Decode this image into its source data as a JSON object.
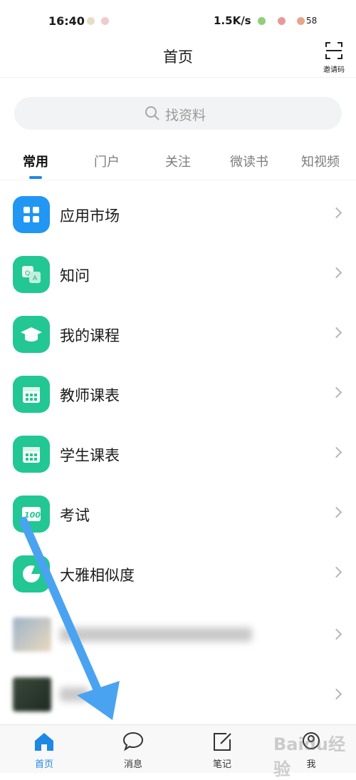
{
  "status_bar": {
    "time": "16:40",
    "net_speed": "1.5K/s",
    "battery": "58"
  },
  "header": {
    "title": "首页",
    "invite_label": "邀请码"
  },
  "search": {
    "placeholder": "找资料"
  },
  "tabs": [
    {
      "label": "常用",
      "active": true
    },
    {
      "label": "门户"
    },
    {
      "label": "关注"
    },
    {
      "label": "微读书"
    },
    {
      "label": "知视频"
    }
  ],
  "list": [
    {
      "label": "应用市场",
      "icon": "app-grid-icon",
      "color": "#2196f3"
    },
    {
      "label": "知问",
      "icon": "qa-icon",
      "color": "#22c793"
    },
    {
      "label": "我的课程",
      "icon": "graduation-cap-icon",
      "color": "#22c793"
    },
    {
      "label": "教师课表",
      "icon": "calendar-icon",
      "color": "#22c793"
    },
    {
      "label": "学生课表",
      "icon": "calendar-icon",
      "color": "#22c793"
    },
    {
      "label": "考试",
      "icon": "exam-100-icon",
      "color": "#22c793"
    },
    {
      "label": "大雅相似度",
      "icon": "similarity-pie-icon",
      "color": "#22c793"
    }
  ],
  "bottom_nav": [
    {
      "label": "首页",
      "icon": "home-icon",
      "active": true
    },
    {
      "label": "消息",
      "icon": "chat-bubble-icon"
    },
    {
      "label": "笔记",
      "icon": "edit-note-icon"
    },
    {
      "label": "我",
      "icon": "profile-icon"
    }
  ],
  "watermark": "Baidu经验",
  "colors": {
    "accent": "#1e88e5",
    "green": "#22c793",
    "arrow": "#4aa3f0"
  }
}
